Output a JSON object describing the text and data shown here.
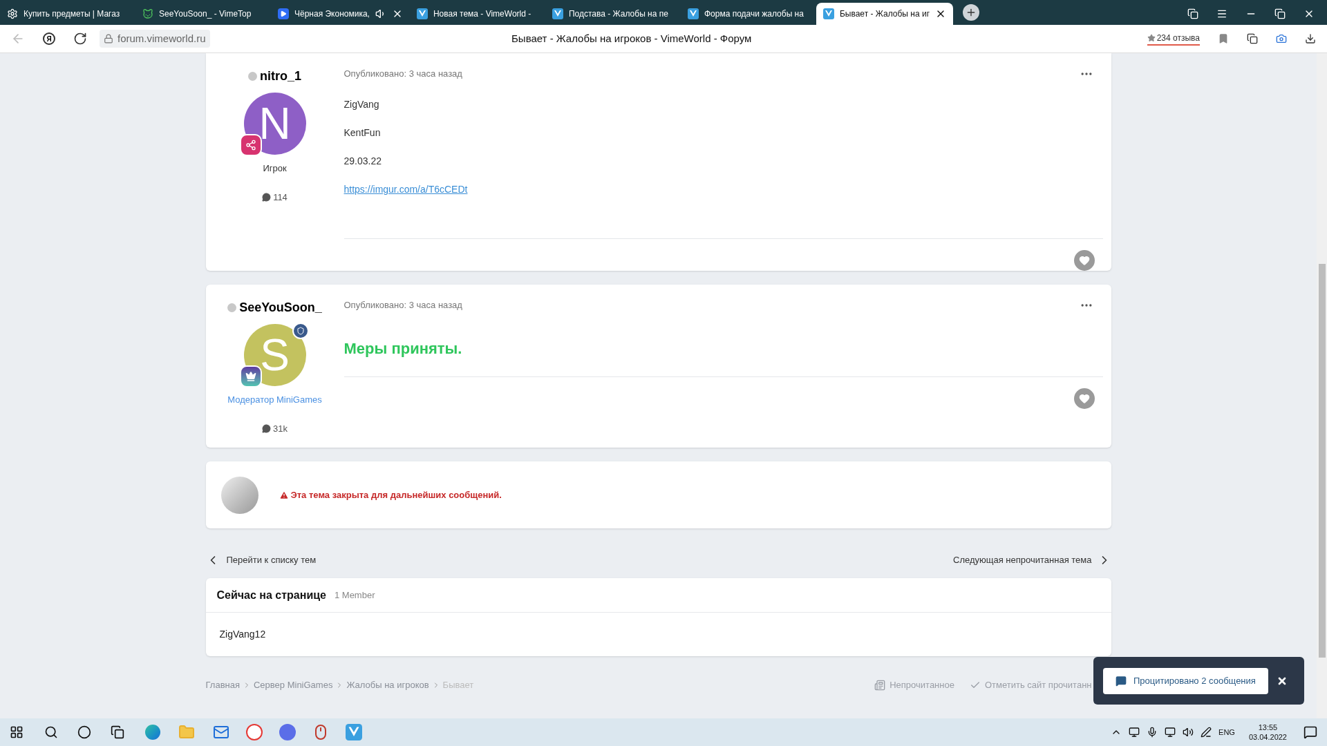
{
  "browser": {
    "tabs": [
      {
        "title": "Купить предметы | Магаз",
        "selected": false,
        "audio": false
      },
      {
        "title": "SeeYouSoon_ - VimeTop",
        "selected": false,
        "audio": false
      },
      {
        "title": "Чёрная Экономика,",
        "selected": false,
        "audio": true
      },
      {
        "title": "Новая тема - VimeWorld -",
        "selected": false,
        "audio": false
      },
      {
        "title": "Подстава - Жалобы на пе",
        "selected": false,
        "audio": false
      },
      {
        "title": "Форма подачи жалобы на",
        "selected": false,
        "audio": false
      },
      {
        "title": "Бывает - Жалобы на иг",
        "selected": true,
        "audio": false
      }
    ],
    "home_button": "Я",
    "address": "forum.vimeworld.ru",
    "page_title": "Бывает - Жалобы на игроков - VimeWorld - Форум",
    "reviews": "234 отзыва"
  },
  "posts": [
    {
      "author": "nitro_1",
      "online": false,
      "avatar_letter": "N",
      "moderator": false,
      "role": "Игрок",
      "posts_count": "114",
      "published": "Опубликовано: 3 часа назад",
      "content": [
        {
          "kind": "text",
          "text": "ZigVang"
        },
        {
          "kind": "text",
          "text": "KentFun"
        },
        {
          "kind": "text",
          "text": "29.03.22"
        },
        {
          "kind": "link",
          "text": "https://imgur.com/a/T6cCEDt"
        }
      ]
    },
    {
      "author": "SeeYouSoon_",
      "online": false,
      "avatar_letter": "S",
      "moderator": true,
      "role": "Модератор MiniGames",
      "posts_count": "31k",
      "published": "Опубликовано: 3 часа назад",
      "content": [
        {
          "kind": "verdict",
          "text": "Меры приняты."
        }
      ]
    }
  ],
  "closed_notice": "Эта тема закрыта для дальнейших сообщений.",
  "nav": {
    "back": "Перейти к списку тем",
    "next": "Следующая непрочитанная тема"
  },
  "online_block": {
    "title": "Сейчас на странице",
    "count": "1 Member",
    "members": [
      "ZigVang12"
    ]
  },
  "breadcrumbs": [
    {
      "label": "Главная",
      "current": false
    },
    {
      "label": "Сервер MiniGames",
      "current": false
    },
    {
      "label": "Жалобы на игроков",
      "current": false
    },
    {
      "label": "Бывает",
      "current": true
    }
  ],
  "footer_links": [
    {
      "kind": "unread",
      "label": "Непрочитанное"
    },
    {
      "kind": "mark",
      "label": "Отметить сайт прочитанн"
    }
  ],
  "toast": {
    "label": "Процитировано 2 сообщения"
  },
  "taskbar": {
    "lang": "ENG",
    "time": "13:55",
    "date": "03.04.2022"
  }
}
